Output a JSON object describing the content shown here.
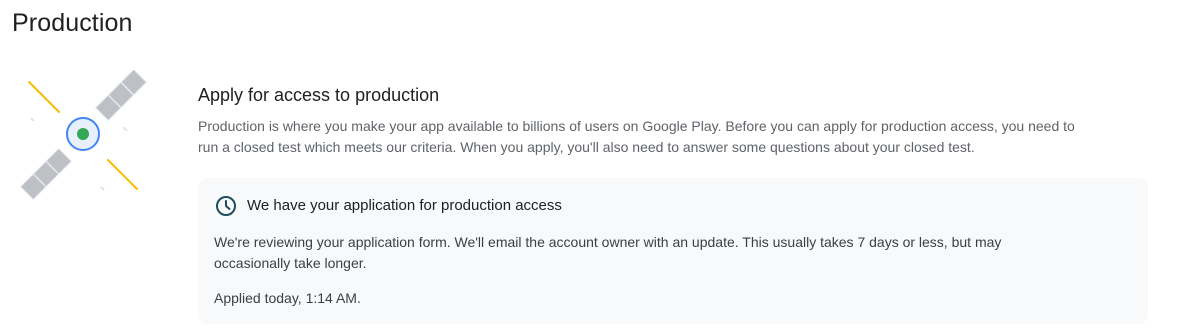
{
  "page": {
    "title": "Production"
  },
  "production_access": {
    "heading": "Apply for access to production",
    "description": "Production is where you make your app available to billions of users on Google Play. Before you can apply for production access, you need to run a closed test which meets our criteria. When you apply, you'll also need to answer some questions about your closed test."
  },
  "application_status": {
    "icon": "clock-icon",
    "title": "We have your application for production access",
    "body": "We're reviewing your application form. We'll email the account owner with an update. This usually takes 7 days or less, but may occasionally take longer.",
    "applied": "Applied today, 1:14 AM."
  },
  "illustration": {
    "icon": "satellite-illustration"
  },
  "colors": {
    "card_background": "#f8f9fa",
    "text_primary": "#202124",
    "text_secondary": "#5f6368",
    "accent_blue": "#4285f4",
    "accent_green": "#34a853",
    "accent_yellow": "#fbbc04",
    "panel_gray": "#bdc1c6",
    "clock_teal": "#1e4d60"
  }
}
